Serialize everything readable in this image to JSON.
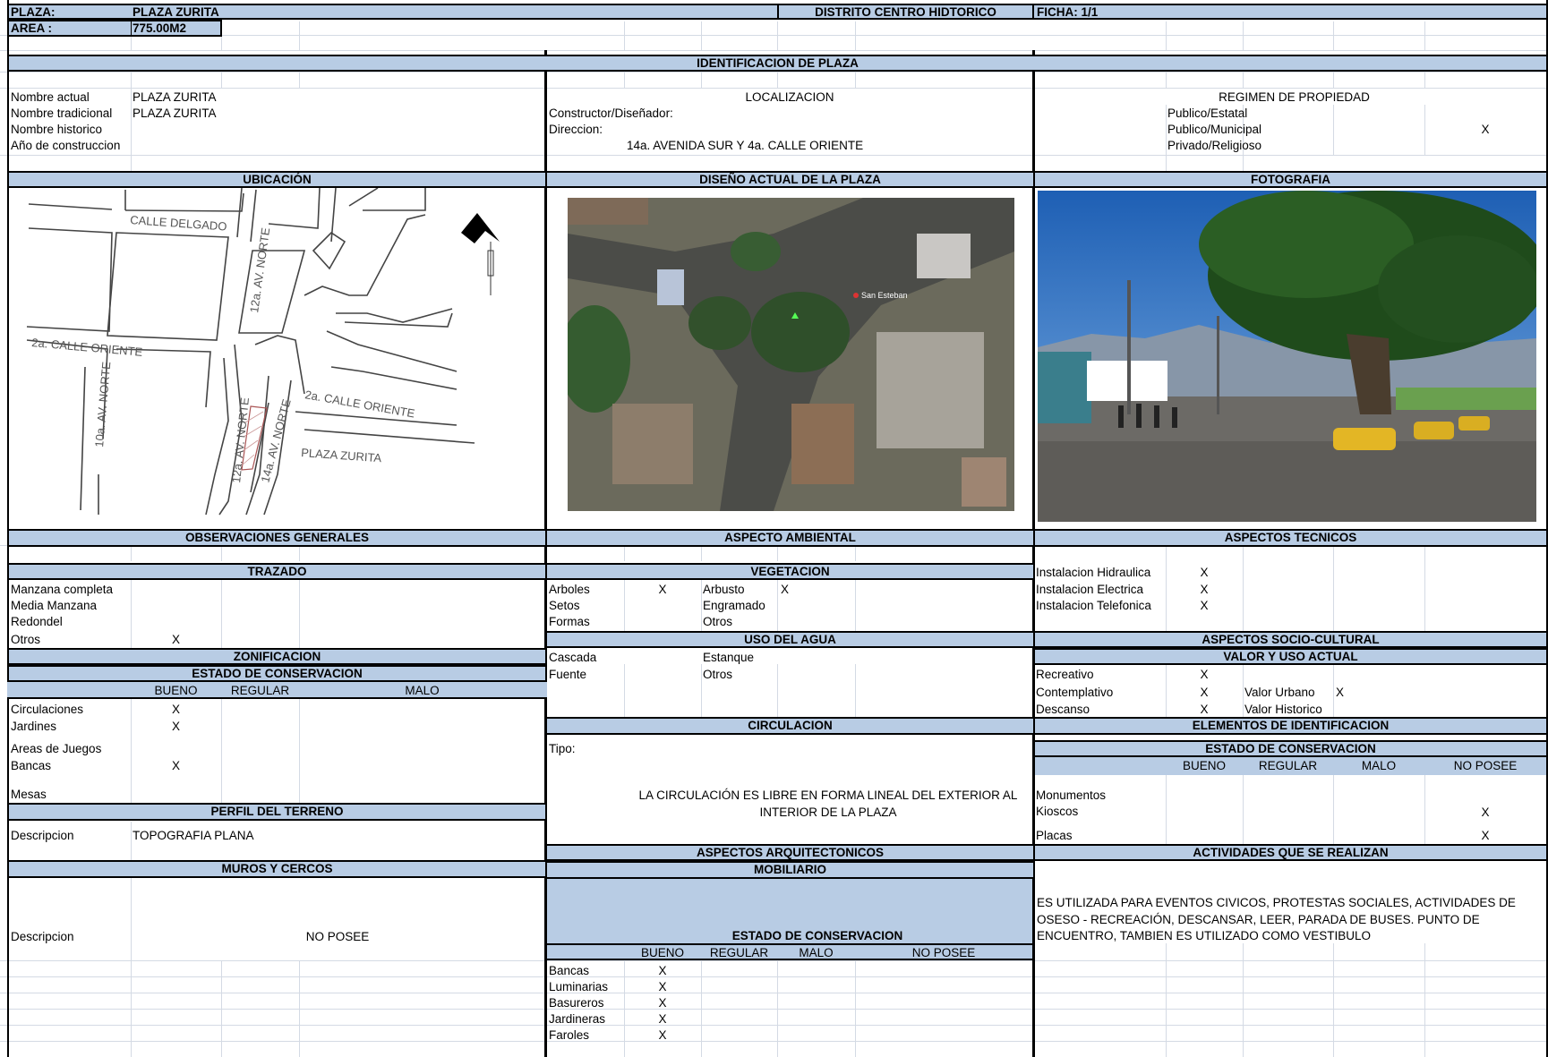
{
  "header": {
    "plaza_label": "PLAZA:",
    "plaza_name": "PLAZA ZURITA",
    "district": "DISTRITO CENTRO HIDTORICO",
    "ficha": "FICHA: 1/1",
    "area_label": "AREA :",
    "area_value": "775.00M2"
  },
  "identificacion": {
    "title": "IDENTIFICACION DE  PLAZA",
    "rows": [
      {
        "label": "Nombre actual",
        "value": "PLAZA ZURITA"
      },
      {
        "label": "Nombre tradicional",
        "value": "PLAZA ZURITA"
      },
      {
        "label": "Nombre historico",
        "value": ""
      },
      {
        "label": "Año de construccion",
        "value": ""
      }
    ],
    "localizacion_title": "LOCALIZACION",
    "constructor_label": "Constructor/Diseñador:",
    "direccion_label": "Direccion:",
    "direccion_value": "14a.  AVENIDA SUR Y 4a. CALLE ORIENTE",
    "regimen_title": "REGIMEN DE PROPIEDAD",
    "regimen": [
      {
        "label": "Publico/Estatal",
        "mark": ""
      },
      {
        "label": "Publico/Municipal",
        "mark": "X"
      },
      {
        "label": "Privado/Religioso",
        "mark": ""
      }
    ]
  },
  "sections": {
    "ubicacion": "UBICACIÓN",
    "diseno": "DISEÑO ACTUAL DE LA PLAZA",
    "fotografia": "FOTOGRAFIA"
  },
  "map": {
    "streets": [
      "CALLE DELGADO",
      "12a. AV. NORTE",
      "2a. CALLE ORIENTE",
      "10a. AV. NORTE",
      "12a. AV. NORTE",
      "14a. AV. NORTE",
      "2a. CALLE ORIENTE",
      "PLAZA ZURITA"
    ]
  },
  "aerial": {
    "pin_label": "San Esteban"
  },
  "observaciones": {
    "title": "OBSERVACIONES GENERALES",
    "trazado_title": "TRAZADO",
    "trazado": [
      {
        "label": "Manzana completa",
        "mark": ""
      },
      {
        "label": "Media Manzana",
        "mark": ""
      },
      {
        "label": "Redondel",
        "mark": ""
      },
      {
        "label": "Otros",
        "mark": "X"
      }
    ],
    "zonificacion_title": "ZONIFICACION",
    "estado_title": "ESTADO DE CONSERVACION",
    "estado_cols": [
      "BUENO",
      "REGULAR",
      "MALO"
    ],
    "estado_rows": [
      {
        "label": "Circulaciones",
        "mark": "X"
      },
      {
        "label": "Jardines",
        "mark": "X"
      },
      {
        "label": "Areas de Juegos",
        "mark": ""
      },
      {
        "label": "Bancas",
        "mark": "X"
      },
      {
        "label": "Mesas",
        "mark": ""
      }
    ],
    "perfil_title": "PERFIL DEL TERRENO",
    "perfil_label": "Descripcion",
    "perfil_value": "TOPOGRAFIA PLANA",
    "muros_title": "MUROS Y CERCOS",
    "muros_label": "Descripcion",
    "muros_value": "NO POSEE"
  },
  "ambiental": {
    "title": "ASPECTO AMBIENTAL",
    "vegetacion_title": "VEGETACION",
    "vegetacion": [
      {
        "label": "Arboles",
        "mark": "X",
        "label2": "Arbusto",
        "mark2": "X"
      },
      {
        "label": "Setos",
        "mark": "",
        "label2": "Engramado",
        "mark2": ""
      },
      {
        "label": "Formas",
        "mark": "",
        "label2": "Otros",
        "mark2": ""
      }
    ],
    "agua_title": "USO DEL AGUA",
    "agua": [
      {
        "label": "Cascada",
        "label2": "Estanque"
      },
      {
        "label": "Fuente",
        "label2": "Otros"
      }
    ],
    "circulacion_title": "CIRCULACION",
    "tipo_label": "Tipo:",
    "circulacion_text": "LA CIRCULACIÓN ES LIBRE EN FORMA LINEAL DEL EXTERIOR AL INTERIOR DE LA PLAZA",
    "arq_title": "ASPECTOS ARQUITECTONICOS",
    "mobiliario_title": "MOBILIARIO",
    "estado_title": "ESTADO DE CONSERVACION",
    "estado_cols": [
      "BUENO",
      "REGULAR",
      "MALO",
      "NO POSEE"
    ],
    "mobiliario": [
      {
        "label": "Bancas",
        "mark": "X"
      },
      {
        "label": "Luminarias",
        "mark": "X"
      },
      {
        "label": "Basureros",
        "mark": "X"
      },
      {
        "label": "Jardineras",
        "mark": "X"
      },
      {
        "label": "Faroles",
        "mark": "X"
      }
    ]
  },
  "tecnicos": {
    "title": "ASPECTOS TECNICOS",
    "rows": [
      {
        "label": "Instalacion Hidraulica",
        "mark": "X"
      },
      {
        "label": "Instalacion Electrica",
        "mark": "X"
      },
      {
        "label": "Instalacion Telefonica",
        "mark": "X"
      }
    ],
    "socio_title": "ASPECTOS SOCIO-CULTURAL",
    "valor_title": "VALOR   Y USO ACTUAL",
    "uso": [
      {
        "label": "Recreativo",
        "mark": "X",
        "label2": "",
        "mark2": ""
      },
      {
        "label": "Contemplativo",
        "mark": "X",
        "label2": "Valor Urbano",
        "mark2": "X"
      },
      {
        "label": "Descanso",
        "mark": "X",
        "label2": "Valor Historico",
        "mark2": ""
      }
    ],
    "elementos_title": "ELEMENTOS DE IDENTIFICACION",
    "estado_title": "ESTADO DE CONSERVACION",
    "estado_cols": [
      "BUENO",
      "REGULAR",
      "MALO",
      "NO POSEE"
    ],
    "elementos": [
      {
        "label": "Monumentos",
        "mark": ""
      },
      {
        "label": "Kioscos",
        "mark": "X"
      },
      {
        "label": "Placas",
        "mark": "X"
      }
    ],
    "actividades_title": "ACTIVIDADES QUE SE REALIZAN",
    "actividades_text": "ES UTILIZADA PARA EVENTOS CIVICOS, PROTESTAS SOCIALES, ACTIVIDADES DE OSESO - RECREACIÓN, DESCANSAR, LEER, PARADA DE BUSES. PUNTO DE ENCUENTRO,  TAMBIEN ES UTILIZADO COMO VESTIBULO"
  },
  "colors": {
    "header_fill": "#b8cce4",
    "grid": "#d4dae4",
    "border": "#000000"
  }
}
